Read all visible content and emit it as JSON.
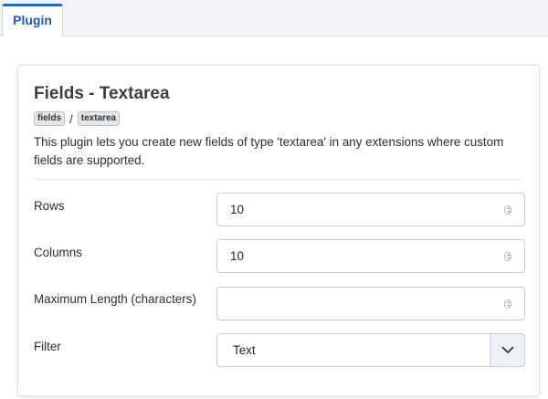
{
  "tabs": [
    {
      "label": "Plugin"
    }
  ],
  "plugin": {
    "title": "Fields - Textarea",
    "tags": [
      "fields",
      "textarea"
    ],
    "separator": "/",
    "description": "This plugin lets you create new fields of type 'textarea' in any extensions where custom fields are supported."
  },
  "fields": {
    "rows": {
      "label": "Rows",
      "value": "10"
    },
    "columns": {
      "label": "Columns",
      "value": "10"
    },
    "max_length": {
      "label": "Maximum Length (characters)",
      "value": ""
    },
    "filter": {
      "label": "Filter",
      "value": "Text"
    }
  },
  "colors": {
    "accent": "#2a69b8",
    "background": "#eef1f6"
  },
  "icons": {
    "spinner": "number-spinner-icon",
    "dropdown": "chevron-down-icon"
  }
}
